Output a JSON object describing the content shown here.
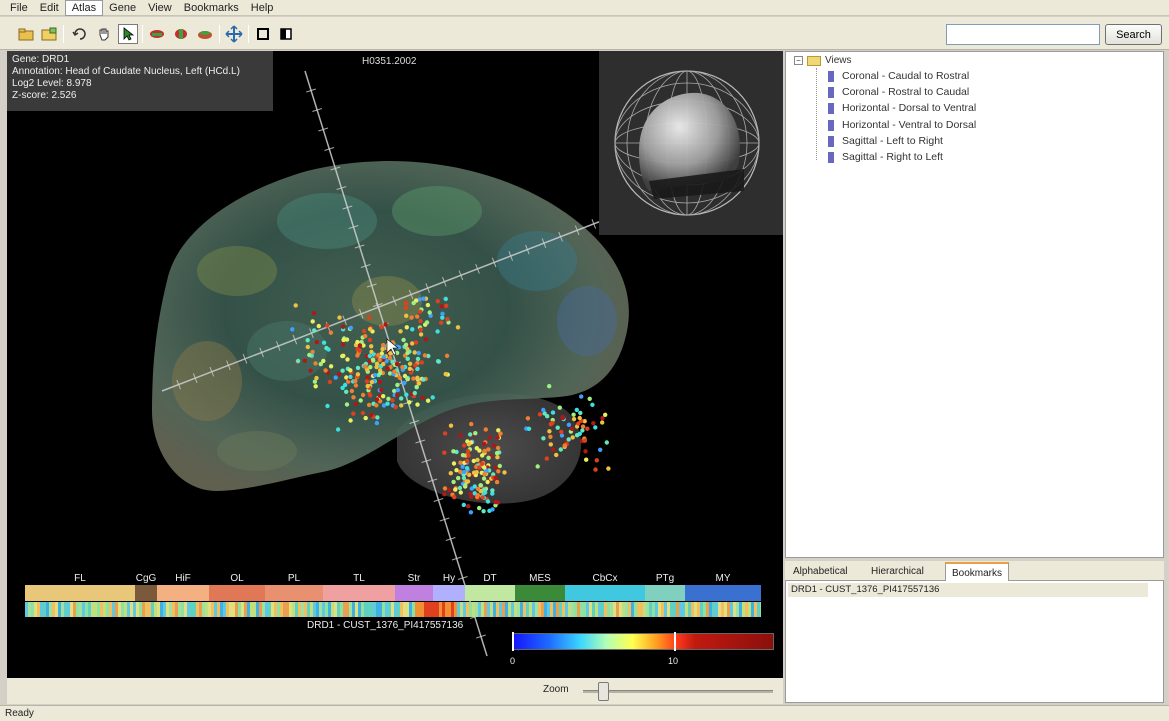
{
  "menu": [
    "File",
    "Edit",
    "Atlas",
    "Gene",
    "View",
    "Bookmarks",
    "Help"
  ],
  "menu_active": "Atlas",
  "toolbar_icons": [
    "open-icon",
    "folder-icon",
    "rotate-icon",
    "hand-icon",
    "pointer-icon",
    "slice-red-icon",
    "slice-green-icon",
    "slice-mixed-icon",
    "move-icon",
    "square-icon",
    "half-square-icon"
  ],
  "search": {
    "value": "",
    "button_label": "Search"
  },
  "info": {
    "gene": "Gene: DRD1",
    "annotation": "Annotation: Head of Caudate Nucleus, Left (HCd.L)",
    "log2": "Log2 Level: 8.978",
    "zscore": "Z-score: 2.526"
  },
  "sample_id": "H0351.2002",
  "regions": [
    "FL",
    "CgG",
    "HiF",
    "OL",
    "PL",
    "TL",
    "Str",
    "Hy",
    "DT",
    "MES",
    "CbCx",
    "PTg",
    "MY"
  ],
  "region_colors": [
    "#e8c878",
    "#7a5a3a",
    "#f4b080",
    "#e07858",
    "#e89070",
    "#f0a0a0",
    "#c080e0",
    "#b0b0ff",
    "#c0e8a0",
    "#3a8a3a",
    "#40c8e0",
    "#80d0c0",
    "#3a70d0"
  ],
  "probe_label": "DRD1 - CUST_1376_PI417557136",
  "scale": {
    "min_label": "0",
    "max_label": "10",
    "colors": [
      "#1414ff",
      "#3cd6ff",
      "#ffff50",
      "#ff3a1a",
      "#8b0f0c"
    ]
  },
  "zoom": {
    "label": "Zoom",
    "level": 0.1
  },
  "status": "Ready",
  "tree": {
    "root": "Views",
    "items": [
      "Coronal - Caudal to Rostral",
      "Coronal - Rostral to Caudal",
      "Horizontal - Dorsal to Ventral",
      "Horizontal - Ventral to Dorsal",
      "Sagittal - Left to Right",
      "Sagittal - Right to Left"
    ]
  },
  "tabs": [
    "Alphabetical",
    "Hierarchical",
    "Bookmarks"
  ],
  "active_tab": "Bookmarks",
  "bookmarks": [
    "DRD1 - CUST_1376_PI417557136"
  ]
}
